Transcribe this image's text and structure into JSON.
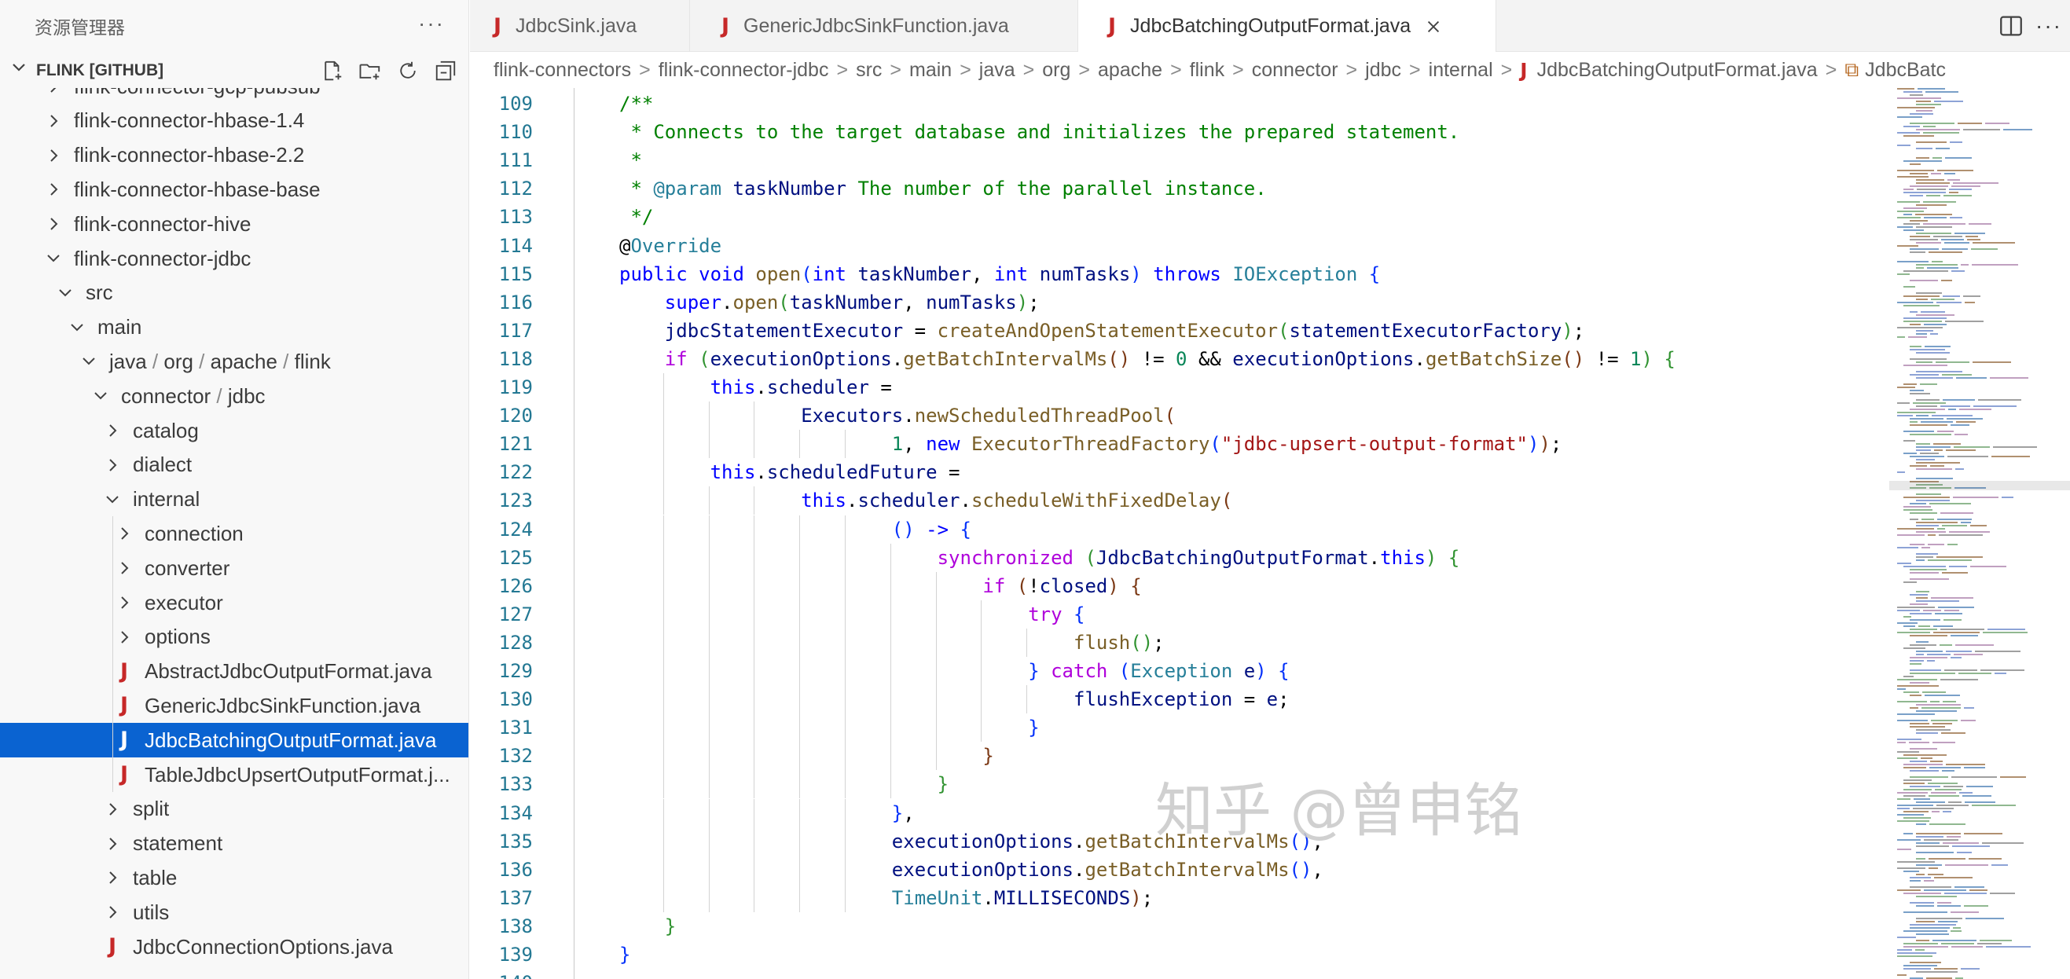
{
  "sidebar": {
    "title": "资源管理器",
    "more_label": "···",
    "section_label": "FLINK [GITHUB]",
    "tools": [
      "new-file-icon",
      "new-folder-icon",
      "refresh-icon",
      "collapse-all-icon"
    ],
    "tree": [
      {
        "label": "flink-connector-gcp-pubsub",
        "depth": 1,
        "type": "folder",
        "open": false
      },
      {
        "label": "flink-connector-hbase-1.4",
        "depth": 1,
        "type": "folder",
        "open": false
      },
      {
        "label": "flink-connector-hbase-2.2",
        "depth": 1,
        "type": "folder",
        "open": false
      },
      {
        "label": "flink-connector-hbase-base",
        "depth": 1,
        "type": "folder",
        "open": false
      },
      {
        "label": "flink-connector-hive",
        "depth": 1,
        "type": "folder",
        "open": false
      },
      {
        "label": "flink-connector-jdbc",
        "depth": 1,
        "type": "folder",
        "open": true
      },
      {
        "label": "src",
        "depth": 2,
        "type": "folder",
        "open": true
      },
      {
        "label": "main",
        "depth": 3,
        "type": "folder",
        "open": true
      },
      {
        "parts": [
          "java",
          "org",
          "apache",
          "flink"
        ],
        "depth": 4,
        "type": "folder",
        "open": true
      },
      {
        "parts": [
          "connector",
          "jdbc"
        ],
        "depth": 5,
        "type": "folder",
        "open": true
      },
      {
        "label": "catalog",
        "depth": 6,
        "type": "folder",
        "open": false
      },
      {
        "label": "dialect",
        "depth": 6,
        "type": "folder",
        "open": false
      },
      {
        "label": "internal",
        "depth": 6,
        "type": "folder",
        "open": true
      },
      {
        "label": "connection",
        "depth": 7,
        "type": "folder",
        "open": false
      },
      {
        "label": "converter",
        "depth": 7,
        "type": "folder",
        "open": false
      },
      {
        "label": "executor",
        "depth": 7,
        "type": "folder",
        "open": false
      },
      {
        "label": "options",
        "depth": 7,
        "type": "folder",
        "open": false
      },
      {
        "label": "AbstractJdbcOutputFormat.java",
        "depth": 7,
        "type": "java"
      },
      {
        "label": "GenericJdbcSinkFunction.java",
        "depth": 7,
        "type": "java"
      },
      {
        "label": "JdbcBatchingOutputFormat.java",
        "depth": 7,
        "type": "java",
        "selected": true
      },
      {
        "label": "TableJdbcUpsertOutputFormat.j...",
        "depth": 7,
        "type": "java"
      },
      {
        "label": "split",
        "depth": 6,
        "type": "folder",
        "open": false
      },
      {
        "label": "statement",
        "depth": 6,
        "type": "folder",
        "open": false
      },
      {
        "label": "table",
        "depth": 6,
        "type": "folder",
        "open": false
      },
      {
        "label": "utils",
        "depth": 6,
        "type": "folder",
        "open": false
      },
      {
        "label": "JdbcConnectionOptions.java",
        "depth": 6,
        "type": "java"
      }
    ],
    "path_sep": "/"
  },
  "tabs": [
    {
      "label": "JdbcSink.java",
      "active": false
    },
    {
      "label": "GenericJdbcSinkFunction.java",
      "active": false
    },
    {
      "label": "JdbcBatchingOutputFormat.java",
      "active": true
    }
  ],
  "tab_actions": [
    "split-editor-icon",
    "more-actions-icon"
  ],
  "breadcrumb": {
    "items": [
      "flink-connectors",
      "flink-connector-jdbc",
      "src",
      "main",
      "java",
      "org",
      "apache",
      "flink",
      "connector",
      "jdbc",
      "internal"
    ],
    "file": "JdbcBatchingOutputFormat.java",
    "symbol": "JdbcBatc",
    "separator": ">"
  },
  "editor": {
    "first_line": 109,
    "lines": [
      {
        "indent": 1,
        "tokens": [
          [
            "cm",
            "/**"
          ]
        ]
      },
      {
        "indent": 1,
        "tokens": [
          [
            "cm",
            " * Connects to the target database and initializes the prepared statement."
          ]
        ]
      },
      {
        "indent": 1,
        "tokens": [
          [
            "cm",
            " *"
          ]
        ]
      },
      {
        "indent": 1,
        "tokens": [
          [
            "cm",
            " * "
          ],
          [
            "an",
            "@param"
          ],
          [
            "cm",
            " "
          ],
          [
            "vr",
            "taskNumber"
          ],
          [
            "cm",
            " The number of the parallel instance."
          ]
        ]
      },
      {
        "indent": 1,
        "tokens": [
          [
            "cm",
            " */"
          ]
        ]
      },
      {
        "indent": 1,
        "tokens": [
          [
            "tx",
            "@"
          ],
          [
            "an",
            "Override"
          ]
        ]
      },
      {
        "indent": 1,
        "tokens": [
          [
            "kw",
            "public"
          ],
          [
            "tx",
            " "
          ],
          [
            "kw",
            "void"
          ],
          [
            "tx",
            " "
          ],
          [
            "fn",
            "open"
          ],
          [
            "br1",
            "("
          ],
          [
            "kw",
            "int"
          ],
          [
            "tx",
            " "
          ],
          [
            "vr",
            "taskNumber"
          ],
          [
            "tx",
            ", "
          ],
          [
            "kw",
            "int"
          ],
          [
            "tx",
            " "
          ],
          [
            "vr",
            "numTasks"
          ],
          [
            "br1",
            ")"
          ],
          [
            "tx",
            " "
          ],
          [
            "kw",
            "throws"
          ],
          [
            "tx",
            " "
          ],
          [
            "ty",
            "IOException"
          ],
          [
            "tx",
            " "
          ],
          [
            "br1",
            "{"
          ]
        ]
      },
      {
        "indent": 2,
        "tokens": [
          [
            "kw",
            "super"
          ],
          [
            "tx",
            "."
          ],
          [
            "fn",
            "open"
          ],
          [
            "br2",
            "("
          ],
          [
            "vr",
            "taskNumber"
          ],
          [
            "tx",
            ", "
          ],
          [
            "vr",
            "numTasks"
          ],
          [
            "br2",
            ")"
          ],
          [
            "tx",
            ";"
          ]
        ]
      },
      {
        "indent": 2,
        "tokens": [
          [
            "vr",
            "jdbcStatementExecutor"
          ],
          [
            "tx",
            " = "
          ],
          [
            "fn",
            "createAndOpenStatementExecutor"
          ],
          [
            "br2",
            "("
          ],
          [
            "vr",
            "statementExecutorFactory"
          ],
          [
            "br2",
            ")"
          ],
          [
            "tx",
            ";"
          ]
        ]
      },
      {
        "indent": 2,
        "tokens": [
          [
            "kw2",
            "if"
          ],
          [
            "tx",
            " "
          ],
          [
            "br2",
            "("
          ],
          [
            "vr",
            "executionOptions"
          ],
          [
            "tx",
            "."
          ],
          [
            "fn",
            "getBatchIntervalMs"
          ],
          [
            "br3",
            "()"
          ],
          [
            "tx",
            " != "
          ],
          [
            "nm",
            "0"
          ],
          [
            "tx",
            " && "
          ],
          [
            "vr",
            "executionOptions"
          ],
          [
            "tx",
            "."
          ],
          [
            "fn",
            "getBatchSize"
          ],
          [
            "br3",
            "()"
          ],
          [
            "tx",
            " != "
          ],
          [
            "nm",
            "1"
          ],
          [
            "br2",
            ")"
          ],
          [
            "tx",
            " "
          ],
          [
            "br2",
            "{"
          ]
        ]
      },
      {
        "indent": 3,
        "tokens": [
          [
            "kw",
            "this"
          ],
          [
            "tx",
            "."
          ],
          [
            "vr",
            "scheduler"
          ],
          [
            "tx",
            " ="
          ]
        ]
      },
      {
        "indent": 5,
        "tokens": [
          [
            "vr",
            "Executors"
          ],
          [
            "tx",
            "."
          ],
          [
            "fn",
            "newScheduledThreadPool"
          ],
          [
            "br3",
            "("
          ]
        ]
      },
      {
        "indent": 7,
        "tokens": [
          [
            "nm",
            "1"
          ],
          [
            "tx",
            ", "
          ],
          [
            "kw",
            "new"
          ],
          [
            "tx",
            " "
          ],
          [
            "fn",
            "ExecutorThreadFactory"
          ],
          [
            "br1",
            "("
          ],
          [
            "st",
            "\"jdbc-upsert-output-format\""
          ],
          [
            "br1",
            ")"
          ],
          [
            "br3",
            ")"
          ],
          [
            "tx",
            ";"
          ]
        ]
      },
      {
        "indent": 3,
        "tokens": [
          [
            "kw",
            "this"
          ],
          [
            "tx",
            "."
          ],
          [
            "vr",
            "scheduledFuture"
          ],
          [
            "tx",
            " ="
          ]
        ]
      },
      {
        "indent": 5,
        "tokens": [
          [
            "kw",
            "this"
          ],
          [
            "tx",
            "."
          ],
          [
            "vr",
            "scheduler"
          ],
          [
            "tx",
            "."
          ],
          [
            "fn",
            "scheduleWithFixedDelay"
          ],
          [
            "br3",
            "("
          ]
        ]
      },
      {
        "indent": 7,
        "tokens": [
          [
            "br1",
            "()"
          ],
          [
            "tx",
            " "
          ],
          [
            "kw",
            "->"
          ],
          [
            "tx",
            " "
          ],
          [
            "br1",
            "{"
          ]
        ]
      },
      {
        "indent": 8,
        "tokens": [
          [
            "kw2",
            "synchronized"
          ],
          [
            "tx",
            " "
          ],
          [
            "br2",
            "("
          ],
          [
            "vr",
            "JdbcBatchingOutputFormat"
          ],
          [
            "tx",
            "."
          ],
          [
            "kw",
            "this"
          ],
          [
            "br2",
            ")"
          ],
          [
            "tx",
            " "
          ],
          [
            "br2",
            "{"
          ]
        ]
      },
      {
        "indent": 9,
        "tokens": [
          [
            "kw2",
            "if"
          ],
          [
            "tx",
            " "
          ],
          [
            "br3",
            "("
          ],
          [
            "tx",
            "!"
          ],
          [
            "vr",
            "closed"
          ],
          [
            "br3",
            ")"
          ],
          [
            "tx",
            " "
          ],
          [
            "br3",
            "{"
          ]
        ]
      },
      {
        "indent": 10,
        "tokens": [
          [
            "kw2",
            "try"
          ],
          [
            "tx",
            " "
          ],
          [
            "br1",
            "{"
          ]
        ]
      },
      {
        "indent": 11,
        "tokens": [
          [
            "fn",
            "flush"
          ],
          [
            "br2",
            "()"
          ],
          [
            "tx",
            ";"
          ]
        ]
      },
      {
        "indent": 10,
        "tokens": [
          [
            "br1",
            "}"
          ],
          [
            "tx",
            " "
          ],
          [
            "kw2",
            "catch"
          ],
          [
            "tx",
            " "
          ],
          [
            "br1",
            "("
          ],
          [
            "ty",
            "Exception"
          ],
          [
            "tx",
            " "
          ],
          [
            "vr",
            "e"
          ],
          [
            "br1",
            ")"
          ],
          [
            "tx",
            " "
          ],
          [
            "br1",
            "{"
          ]
        ]
      },
      {
        "indent": 11,
        "tokens": [
          [
            "vr",
            "flushException"
          ],
          [
            "tx",
            " = "
          ],
          [
            "vr",
            "e"
          ],
          [
            "tx",
            ";"
          ]
        ]
      },
      {
        "indent": 10,
        "tokens": [
          [
            "br1",
            "}"
          ]
        ]
      },
      {
        "indent": 9,
        "tokens": [
          [
            "br3",
            "}"
          ]
        ]
      },
      {
        "indent": 8,
        "tokens": [
          [
            "br2",
            "}"
          ]
        ]
      },
      {
        "indent": 7,
        "tokens": [
          [
            "br1",
            "}"
          ],
          [
            "tx",
            ","
          ]
        ]
      },
      {
        "indent": 7,
        "tokens": [
          [
            "vr",
            "executionOptions"
          ],
          [
            "tx",
            "."
          ],
          [
            "fn",
            "getBatchIntervalMs"
          ],
          [
            "br1",
            "()"
          ],
          [
            "tx",
            ","
          ]
        ]
      },
      {
        "indent": 7,
        "tokens": [
          [
            "vr",
            "executionOptions"
          ],
          [
            "tx",
            "."
          ],
          [
            "fn",
            "getBatchIntervalMs"
          ],
          [
            "br1",
            "()"
          ],
          [
            "tx",
            ","
          ]
        ]
      },
      {
        "indent": 7,
        "tokens": [
          [
            "ty",
            "TimeUnit"
          ],
          [
            "tx",
            "."
          ],
          [
            "vr",
            "MILLISECONDS"
          ],
          [
            "br3",
            ")"
          ],
          [
            "tx",
            ";"
          ]
        ]
      },
      {
        "indent": 2,
        "tokens": [
          [
            "br2",
            "}"
          ]
        ]
      },
      {
        "indent": 1,
        "tokens": [
          [
            "br1",
            "}"
          ]
        ]
      },
      {
        "indent": 1,
        "tokens": [
          [
            "tx",
            ""
          ]
        ]
      }
    ]
  },
  "watermark": "知乎 @曾申铭",
  "colors": {
    "selection": "#0a63d1",
    "java_icon": "#c62828",
    "line_number": "#237893"
  }
}
